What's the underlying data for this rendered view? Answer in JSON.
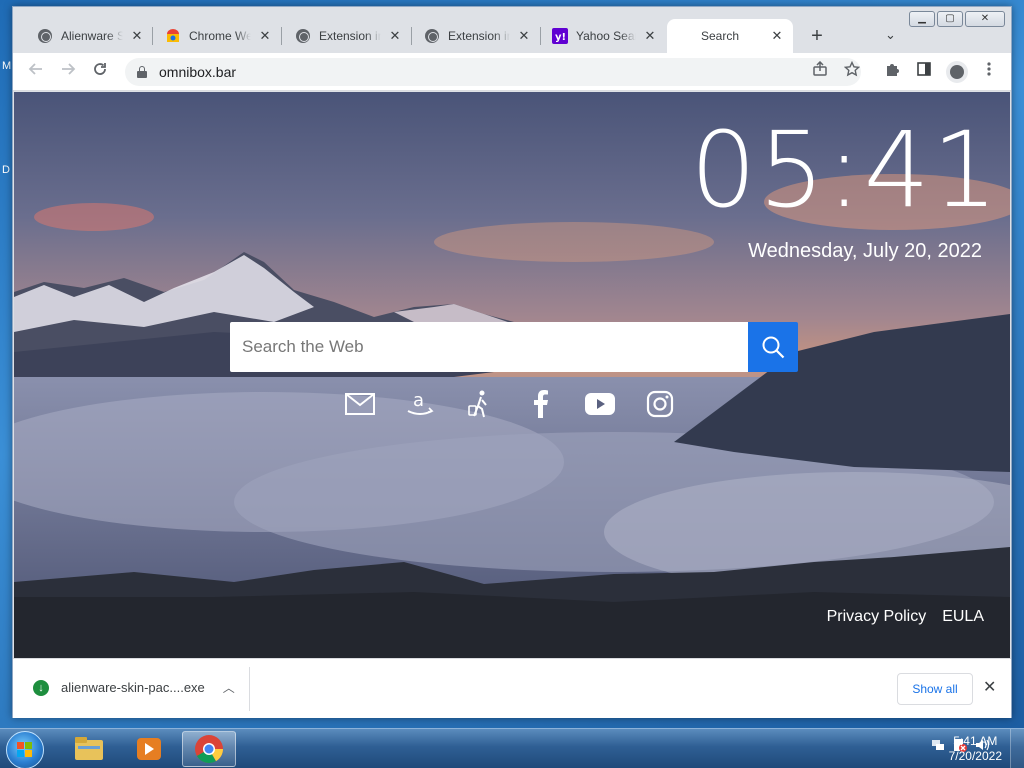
{
  "desktop": {
    "labels": [
      "M",
      "D"
    ]
  },
  "browser": {
    "tabs": [
      {
        "label": "Alienware Skin Pack",
        "icon": "globe-icon"
      },
      {
        "label": "Chrome Web Store",
        "icon": "chrome-web-store-icon"
      },
      {
        "label": "Extension install",
        "icon": "globe-icon"
      },
      {
        "label": "Extension install",
        "icon": "globe-icon"
      },
      {
        "label": "Yahoo Search",
        "icon": "yahoo-icon"
      },
      {
        "label": "Search",
        "icon": "none",
        "active": true
      }
    ],
    "newtab_label": "+",
    "tab_search_label": "⌄",
    "window_controls": {
      "minimize": "▁",
      "maximize": "▢",
      "close": "✕"
    },
    "url": "omnibox.bar"
  },
  "page": {
    "time": "05:41",
    "date": "Wednesday, July 20, 2022",
    "search_placeholder": "Search the Web",
    "quick_links": [
      "gmail-icon",
      "amazon-icon",
      "travel-icon",
      "facebook-icon",
      "youtube-icon",
      "instagram-icon"
    ],
    "footer": {
      "privacy": "Privacy Policy",
      "eula": "EULA"
    }
  },
  "downloads": {
    "filename": "alienware-skin-pac....exe",
    "show_all": "Show all"
  },
  "taskbar": {
    "clock_time": "5:41 AM",
    "clock_date": "7/20/2022"
  },
  "colors": {
    "accent": "#1a73e8",
    "download_ok": "#1e8e3e",
    "taskbar": "#2f5f94"
  }
}
